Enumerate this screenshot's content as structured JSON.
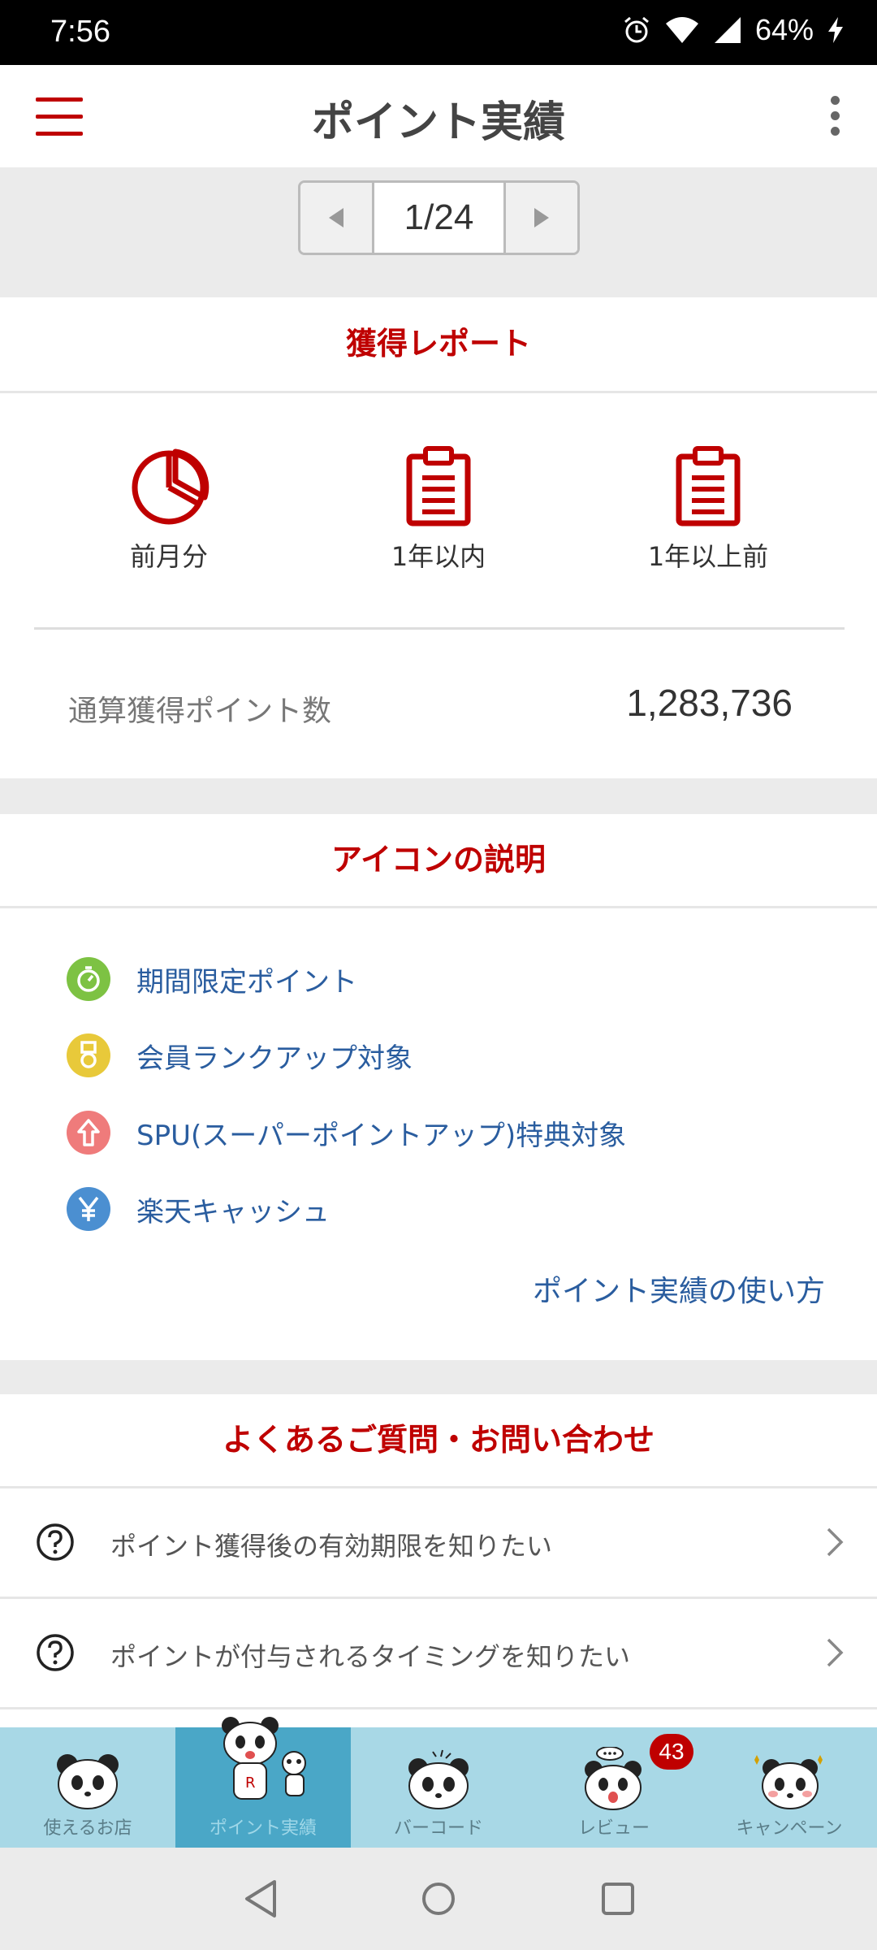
{
  "status_bar": {
    "time": "7:56",
    "battery": "64%"
  },
  "app_bar": {
    "title": "ポイント実績"
  },
  "pager": {
    "page": "1/24"
  },
  "report": {
    "heading": "獲得レポート",
    "items": [
      {
        "label": "前月分",
        "icon": "pie-chart-icon"
      },
      {
        "label": "1年以内",
        "icon": "clipboard-icon"
      },
      {
        "label": "1年以上前",
        "icon": "clipboard-icon"
      }
    ],
    "total_label": "通算獲得ポイント数",
    "total_value": "1,283,736"
  },
  "legend": {
    "heading": "アイコンの説明",
    "items": [
      {
        "label": "期間限定ポイント",
        "icon": "timer-icon",
        "color": "#7dc243"
      },
      {
        "label": "会員ランクアップ対象",
        "icon": "medal-icon",
        "color": "#e8c93a"
      },
      {
        "label": "SPU(スーパーポイントアップ)特典対象",
        "icon": "arrow-up-icon",
        "color": "#ef7b7b"
      },
      {
        "label": "楽天キャッシュ",
        "icon": "yen-icon",
        "color": "#4b8fd1"
      }
    ],
    "howto_link": "ポイント実績の使い方"
  },
  "faq": {
    "heading": "よくあるご質問・お問い合わせ",
    "items": [
      {
        "label": "ポイント獲得後の有効期限を知りたい"
      },
      {
        "label": "ポイントが付与されるタイミングを知りたい"
      }
    ]
  },
  "bottom_nav": {
    "items": [
      {
        "label": "使えるお店"
      },
      {
        "label": "ポイント実績",
        "active": true
      },
      {
        "label": "バーコード"
      },
      {
        "label": "レビュー",
        "badge": "43"
      },
      {
        "label": "キャンペーン"
      }
    ]
  },
  "colors": {
    "accent": "#bf0000",
    "link": "#2a5d9f",
    "nav_bg": "#a8d8e6",
    "nav_active": "#4aa7c7"
  }
}
